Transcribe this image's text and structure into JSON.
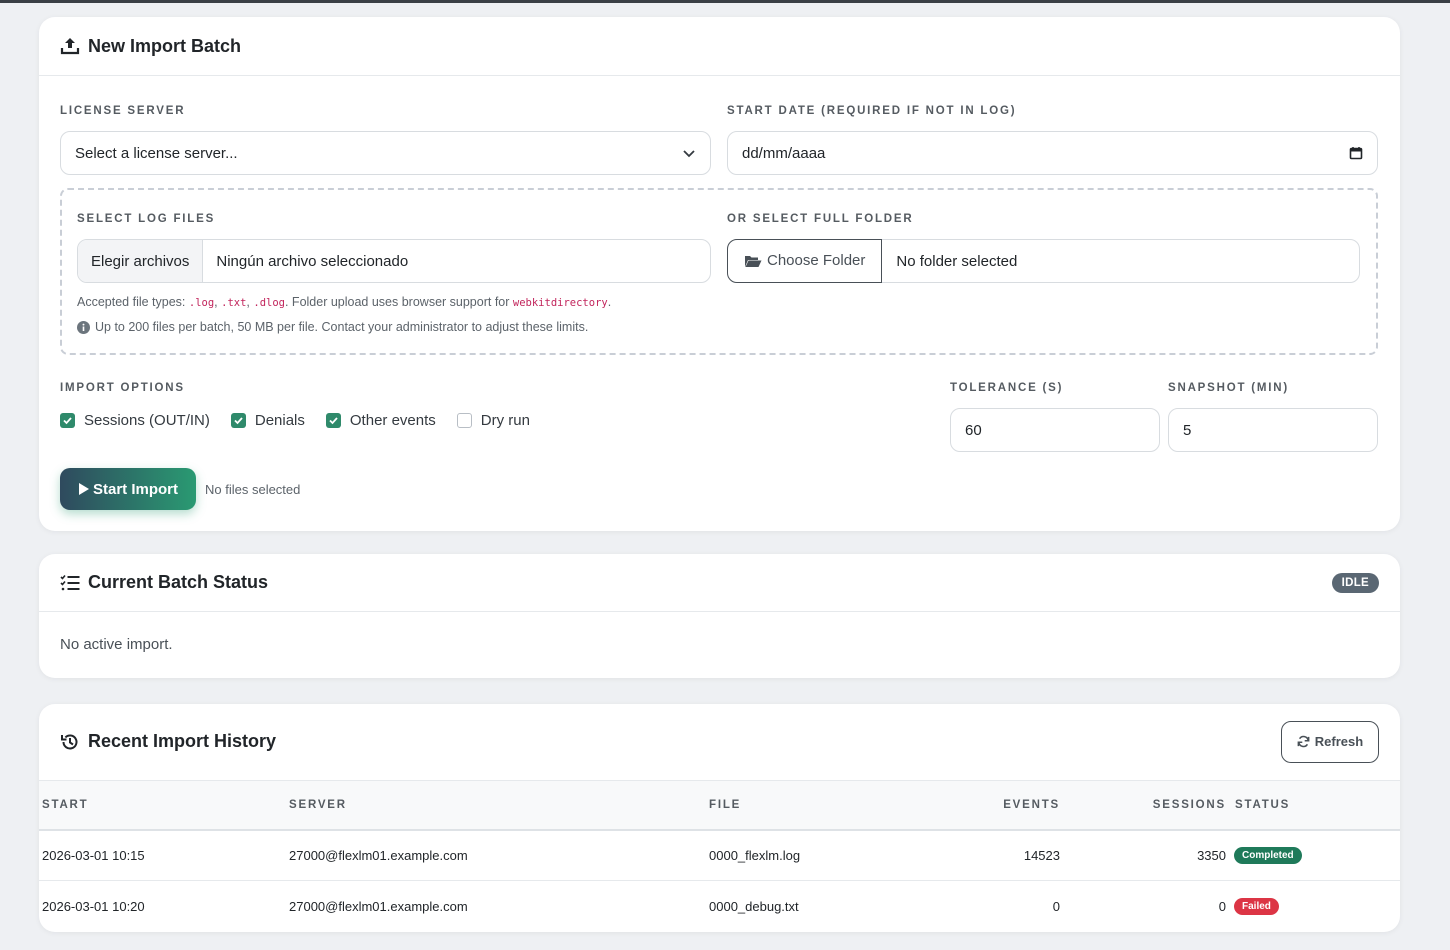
{
  "new_import": {
    "title": "New Import Batch",
    "license_server": {
      "label": "LICENSE SERVER",
      "value": "Select a license server..."
    },
    "start_date": {
      "label": "START DATE (REQUIRED IF NOT IN LOG)",
      "value": "dd/mm/aaaa"
    },
    "log_files": {
      "label": "SELECT LOG FILES",
      "button": "Elegir archivos",
      "status": "Ningún archivo seleccionado"
    },
    "folder": {
      "label": "OR SELECT FULL FOLDER",
      "button": "Choose Folder",
      "status": "No folder selected"
    },
    "hint": {
      "prefix": "Accepted file types: ",
      "type1": ".log",
      "sep1": ", ",
      "type2": ".txt",
      "sep2": ", ",
      "type3": ".dlog",
      "middle": ". Folder upload uses browser support for ",
      "attr": "webkitdirectory",
      "end": "."
    },
    "limits": "Up to 200 files per batch, 50 MB per file. Contact your administrator to adjust these limits.",
    "import_options": {
      "label": "IMPORT OPTIONS",
      "items": [
        {
          "label": "Sessions (OUT/IN)",
          "checked": true
        },
        {
          "label": "Denials",
          "checked": true
        },
        {
          "label": "Other events",
          "checked": true
        },
        {
          "label": "Dry run",
          "checked": false
        }
      ]
    },
    "tolerance": {
      "label": "TOLERANCE (S)",
      "value": "60"
    },
    "snapshot": {
      "label": "SNAPSHOT (MIN)",
      "value": "5"
    },
    "start_button": "Start Import",
    "start_status": "No files selected"
  },
  "batch_status": {
    "title": "Current Batch Status",
    "badge": "IDLE",
    "message": "No active import."
  },
  "history": {
    "title": "Recent Import History",
    "refresh": "Refresh",
    "columns": [
      "START",
      "SERVER",
      "FILE",
      "EVENTS",
      "SESSIONS",
      "STATUS"
    ],
    "rows": [
      {
        "start": "2026-03-01 10:15",
        "server": "27000@flexlm01.example.com",
        "file": "0000_flexlm.log",
        "events": "14523",
        "sessions": "3350",
        "status": "Completed",
        "status_color": "#1f7a5a"
      },
      {
        "start": "2026-03-01 10:20",
        "server": "27000@flexlm01.example.com",
        "file": "0000_debug.txt",
        "events": "0",
        "sessions": "0",
        "status": "Failed",
        "status_color": "#dc3545"
      }
    ]
  },
  "colors": {
    "accent_start": "#2f4a5e",
    "accent_end": "#2a9a72",
    "checkbox": "#2f8a6b",
    "idle_badge": "#5a6773"
  }
}
